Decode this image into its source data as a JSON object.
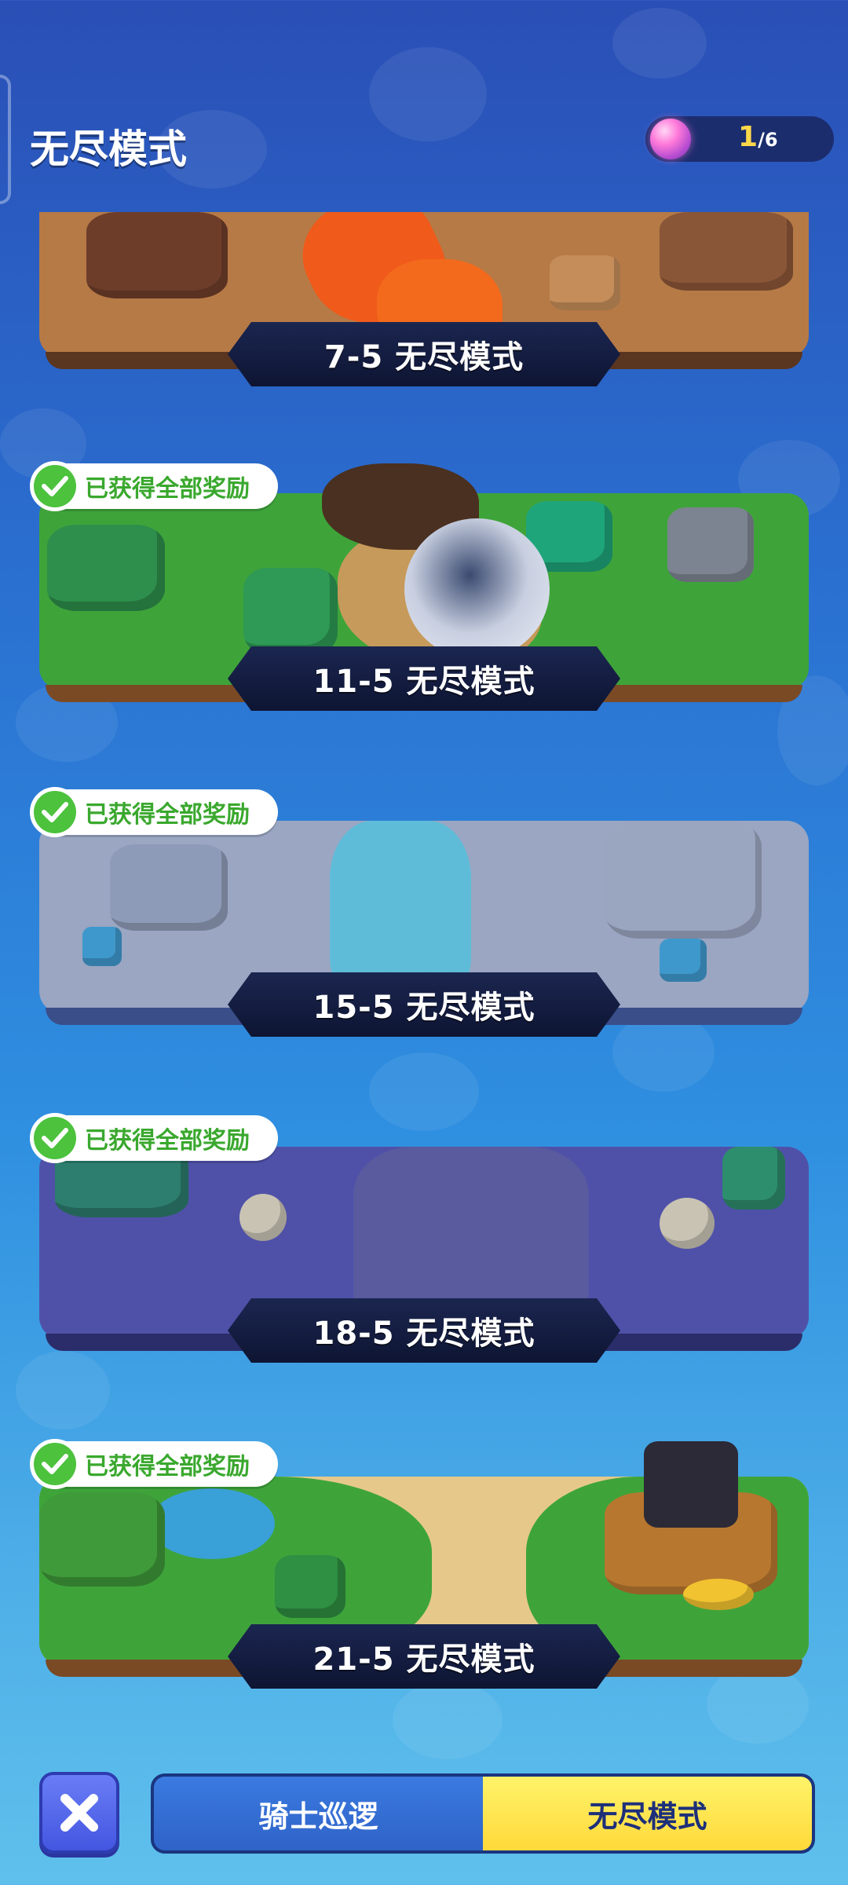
{
  "header": {
    "title": "无尽模式",
    "counter": {
      "current": "1",
      "total": "/6",
      "icon": "gem-icon"
    }
  },
  "levels": [
    {
      "label": "7-5 无尽模式",
      "theme": "lava",
      "reward_claimed": false
    },
    {
      "label": "11-5 无尽模式",
      "theme": "forest",
      "reward_claimed": true
    },
    {
      "label": "15-5 无尽模式",
      "theme": "ice",
      "reward_claimed": true
    },
    {
      "label": "18-5 无尽模式",
      "theme": "graveyard",
      "reward_claimed": true
    },
    {
      "label": "21-5 无尽模式",
      "theme": "beach",
      "reward_claimed": true
    }
  ],
  "reward_badge_text": "已获得全部奖励",
  "bottom": {
    "close_icon": "close-icon",
    "tabs": [
      {
        "label": "骑士巡逻",
        "active": false
      },
      {
        "label": "无尽模式",
        "active": true
      }
    ]
  },
  "colors": {
    "active_tab": "#ffd93a",
    "reward_green": "#4cc23d",
    "counter_highlight": "#ffd84a"
  }
}
